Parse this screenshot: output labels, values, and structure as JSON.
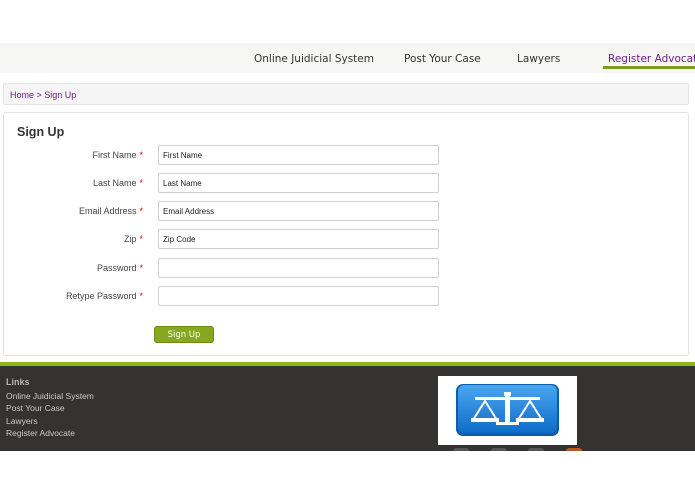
{
  "nav": {
    "items": [
      {
        "label": "Online Juidicial System"
      },
      {
        "label": "Post Your Case"
      },
      {
        "label": "Lawyers"
      },
      {
        "label": "Register Advocate"
      }
    ]
  },
  "breadcrumb": {
    "text": "Home > Sign Up"
  },
  "form": {
    "title": "Sign Up",
    "fields": [
      {
        "label": "First Name",
        "placeholder": "First Name",
        "required": "*"
      },
      {
        "label": "Last Name",
        "placeholder": "Last Name",
        "required": "*"
      },
      {
        "label": "Email Address",
        "placeholder": "Email Address",
        "required": "*"
      },
      {
        "label": "Zip",
        "placeholder": "Zip Code",
        "required": "*"
      },
      {
        "label": "Password",
        "placeholder": "",
        "required": "*"
      },
      {
        "label": "Retype Password",
        "placeholder": "",
        "required": "*"
      }
    ],
    "submit_label": "Sign Up"
  },
  "footer": {
    "heading": "Links",
    "links": [
      {
        "label": "Online Juidicial System"
      },
      {
        "label": "Post Your Case"
      },
      {
        "label": "Lawyers"
      },
      {
        "label": "Register Advocate"
      }
    ],
    "logo_icon": "scales-of-justice-icon"
  },
  "colors": {
    "accent_green": "#86a81e",
    "active_purple": "#6b1f86",
    "footer_bg": "#353331",
    "logo_blue": "#1a7ed8"
  }
}
